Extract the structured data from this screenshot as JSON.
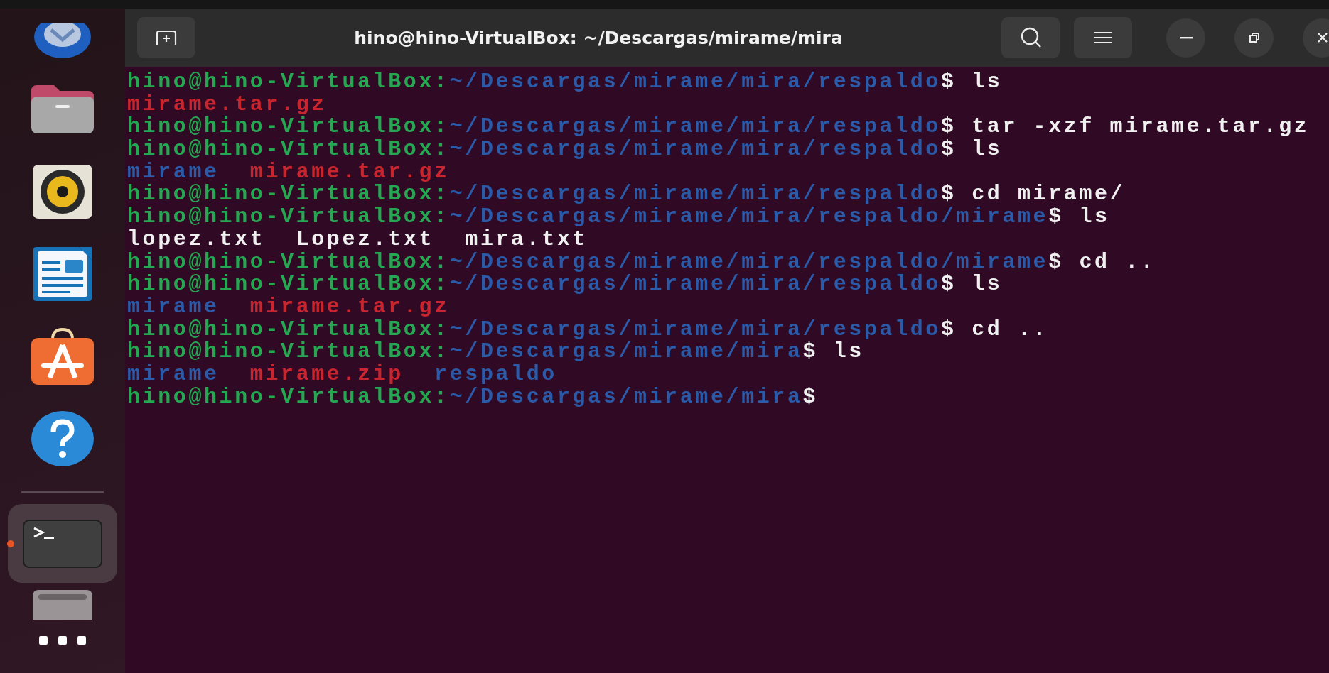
{
  "dock": {
    "items": [
      {
        "kind": "mail",
        "running": false
      },
      {
        "kind": "folder",
        "running": false
      },
      {
        "kind": "speaker",
        "running": false
      },
      {
        "kind": "document",
        "running": false
      },
      {
        "kind": "store",
        "running": false
      },
      {
        "kind": "help",
        "running": false
      },
      {
        "kind": "separator"
      },
      {
        "kind": "terminal",
        "running": true
      },
      {
        "kind": "drive",
        "running": false
      },
      {
        "kind": "grid",
        "running": false
      }
    ]
  },
  "window": {
    "title": "hino@hino-VirtualBox: ~/Descargas/mirame/mira"
  },
  "terminal": {
    "lines": [
      {
        "kind": "prompt",
        "user": "hino@hino-VirtualBox:",
        "path": "~/Descargas/mirame/mira/respaldo",
        "symbol": "$",
        "command": "ls"
      },
      {
        "kind": "output",
        "items": [
          {
            "text": "mirame.tar.gz",
            "kind": "archive"
          }
        ]
      },
      {
        "kind": "prompt",
        "user": "hino@hino-VirtualBox:",
        "path": "~/Descargas/mirame/mira/respaldo",
        "symbol": "$",
        "command": "tar -xzf mirame.tar.gz"
      },
      {
        "kind": "prompt",
        "user": "hino@hino-VirtualBox:",
        "path": "~/Descargas/mirame/mira/respaldo",
        "symbol": "$",
        "command": "ls"
      },
      {
        "kind": "output",
        "items": [
          {
            "text": "mirame",
            "kind": "directory"
          },
          {
            "text": "mirame.tar.gz",
            "kind": "archive"
          }
        ]
      },
      {
        "kind": "prompt",
        "user": "hino@hino-VirtualBox:",
        "path": "~/Descargas/mirame/mira/respaldo",
        "symbol": "$",
        "command": "cd mirame/"
      },
      {
        "kind": "prompt",
        "user": "hino@hino-VirtualBox:",
        "path": "~/Descargas/mirame/mira/respaldo/mirame",
        "symbol": "$",
        "command": "ls"
      },
      {
        "kind": "output",
        "items": [
          {
            "text": "lopez.txt",
            "kind": "file"
          },
          {
            "text": "Lopez.txt",
            "kind": "file"
          },
          {
            "text": "mira.txt",
            "kind": "file"
          }
        ]
      },
      {
        "kind": "prompt",
        "user": "hino@hino-VirtualBox:",
        "path": "~/Descargas/mirame/mira/respaldo/mirame",
        "symbol": "$",
        "command": "cd .."
      },
      {
        "kind": "prompt",
        "user": "hino@hino-VirtualBox:",
        "path": "~/Descargas/mirame/mira/respaldo",
        "symbol": "$",
        "command": "ls"
      },
      {
        "kind": "output",
        "items": [
          {
            "text": "mirame",
            "kind": "directory"
          },
          {
            "text": "mirame.tar.gz",
            "kind": "archive"
          }
        ]
      },
      {
        "kind": "prompt",
        "user": "hino@hino-VirtualBox:",
        "path": "~/Descargas/mirame/mira/respaldo",
        "symbol": "$",
        "command": "cd .."
      },
      {
        "kind": "prompt",
        "user": "hino@hino-VirtualBox:",
        "path": "~/Descargas/mirame/mira",
        "symbol": "$",
        "command": "ls"
      },
      {
        "kind": "output",
        "items": [
          {
            "text": "mirame",
            "kind": "directory"
          },
          {
            "text": "mirame.zip",
            "kind": "archive"
          },
          {
            "text": "respaldo",
            "kind": "directory"
          }
        ]
      },
      {
        "kind": "prompt",
        "user": "hino@hino-VirtualBox:",
        "path": "~/Descargas/mirame/mira",
        "symbol": "$"
      }
    ]
  }
}
